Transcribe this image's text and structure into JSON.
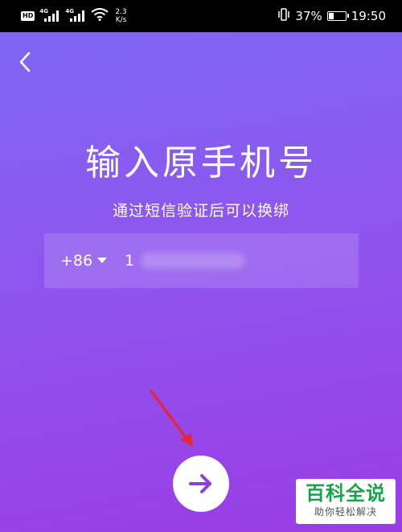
{
  "status_bar": {
    "hd_badge": "HD",
    "network1": "4G",
    "network2": "4G",
    "speed_value": "2.3",
    "speed_unit": "K/s",
    "battery_percent": "37%",
    "battery_level": 0.37,
    "time": "19:50",
    "icons": [
      "hd-icon",
      "signal-icon",
      "wifi-icon",
      "vibrate-icon",
      "battery-icon"
    ]
  },
  "header": {
    "back_icon": "chevron-left-icon"
  },
  "main": {
    "title": "输入原手机号",
    "subtitle": "通过短信验证后可以换绑",
    "phone_field": {
      "country_code": "+86",
      "dropdown_icon": "caret-down-icon",
      "value_prefix": "1"
    },
    "next_icon": "arrow-right-icon"
  },
  "annotation": {
    "icon": "red-arrow-icon",
    "color": "#e0283c"
  },
  "watermark": {
    "main": "百科全说",
    "sub": "助你轻松解决"
  },
  "colors": {
    "gradient_start": "#7d67f2",
    "gradient_end": "#9a3ce6",
    "accent": "#8e3fe0",
    "watermark_green": "#16a34a"
  }
}
